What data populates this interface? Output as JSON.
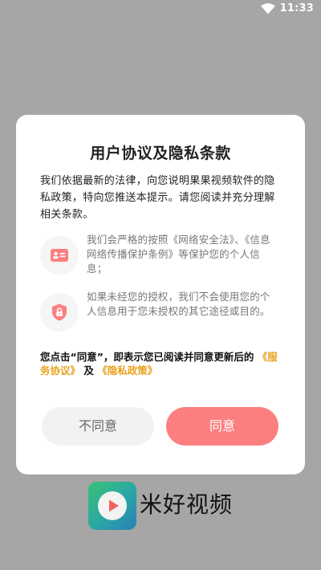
{
  "status_bar": {
    "time": "11:33",
    "wifi_icon": "wifi-icon"
  },
  "dialog": {
    "title": "用户协议及隐私条款",
    "intro": "我们依据最新的法律，向您说明果果视频软件的隐私政策，特向您推送本提示。请您阅读并充分理解相关条款。",
    "features": [
      {
        "icon": "id-card-icon",
        "text": "我们会严格的按照《网络安全法》、《信息网络传播保护条例》等保护您的个人信息；"
      },
      {
        "icon": "lock-shield-icon",
        "text": "如果未经您的授权，我们不会使用您的个人信息用于您未授权的其它途径或目的。"
      }
    ],
    "consent_prefix": "您点击“同意”，即表示您已阅读并同意更新后的",
    "service_link": "《服务协议》",
    "consent_and": "及",
    "privacy_link": "《隐私政策》",
    "decline_label": "不同意",
    "agree_label": "同意",
    "colors": {
      "accent": "#fc7f80",
      "link": "#e8a21c",
      "overlay": "#a6a6a6"
    }
  },
  "brand": {
    "name": "米好视频",
    "logo_icon": "play-logo-icon"
  }
}
